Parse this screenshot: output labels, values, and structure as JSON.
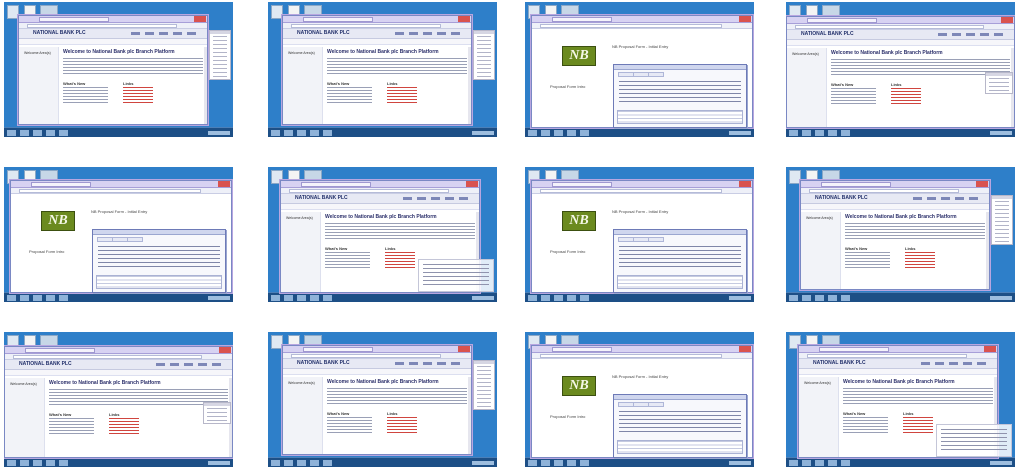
{
  "grid": {
    "tiles": [
      {
        "variant": "welcome"
      },
      {
        "variant": "welcome"
      },
      {
        "variant": "nb-dialog"
      },
      {
        "variant": "welcome-wide"
      },
      {
        "variant": "nb-dialog"
      },
      {
        "variant": "login-welcome"
      },
      {
        "variant": "nb-dialog"
      },
      {
        "variant": "welcome"
      },
      {
        "variant": "welcome-wide"
      },
      {
        "variant": "welcome"
      },
      {
        "variant": "nb-dialog"
      },
      {
        "variant": "login-welcome"
      }
    ]
  },
  "bank": {
    "name": "NATIONAL BANK PLC",
    "welcome_heading": "Welcome to National Bank plc Branch Platform",
    "sidebar_welcome": "Welcome Area(s)",
    "whats_new": "What's New",
    "links": "Links",
    "logo_text": "NB",
    "proposal_header": "NB Proposal Form - Initial Entry",
    "proposal_caption": "Proposal Form Intro"
  },
  "colors": {
    "desktop": "#2e7fc9",
    "taskbar": "#1d4f86",
    "window_frame": "#7a88c4",
    "logo_green": "#6b8a1f",
    "link_red": "#d0453f"
  }
}
